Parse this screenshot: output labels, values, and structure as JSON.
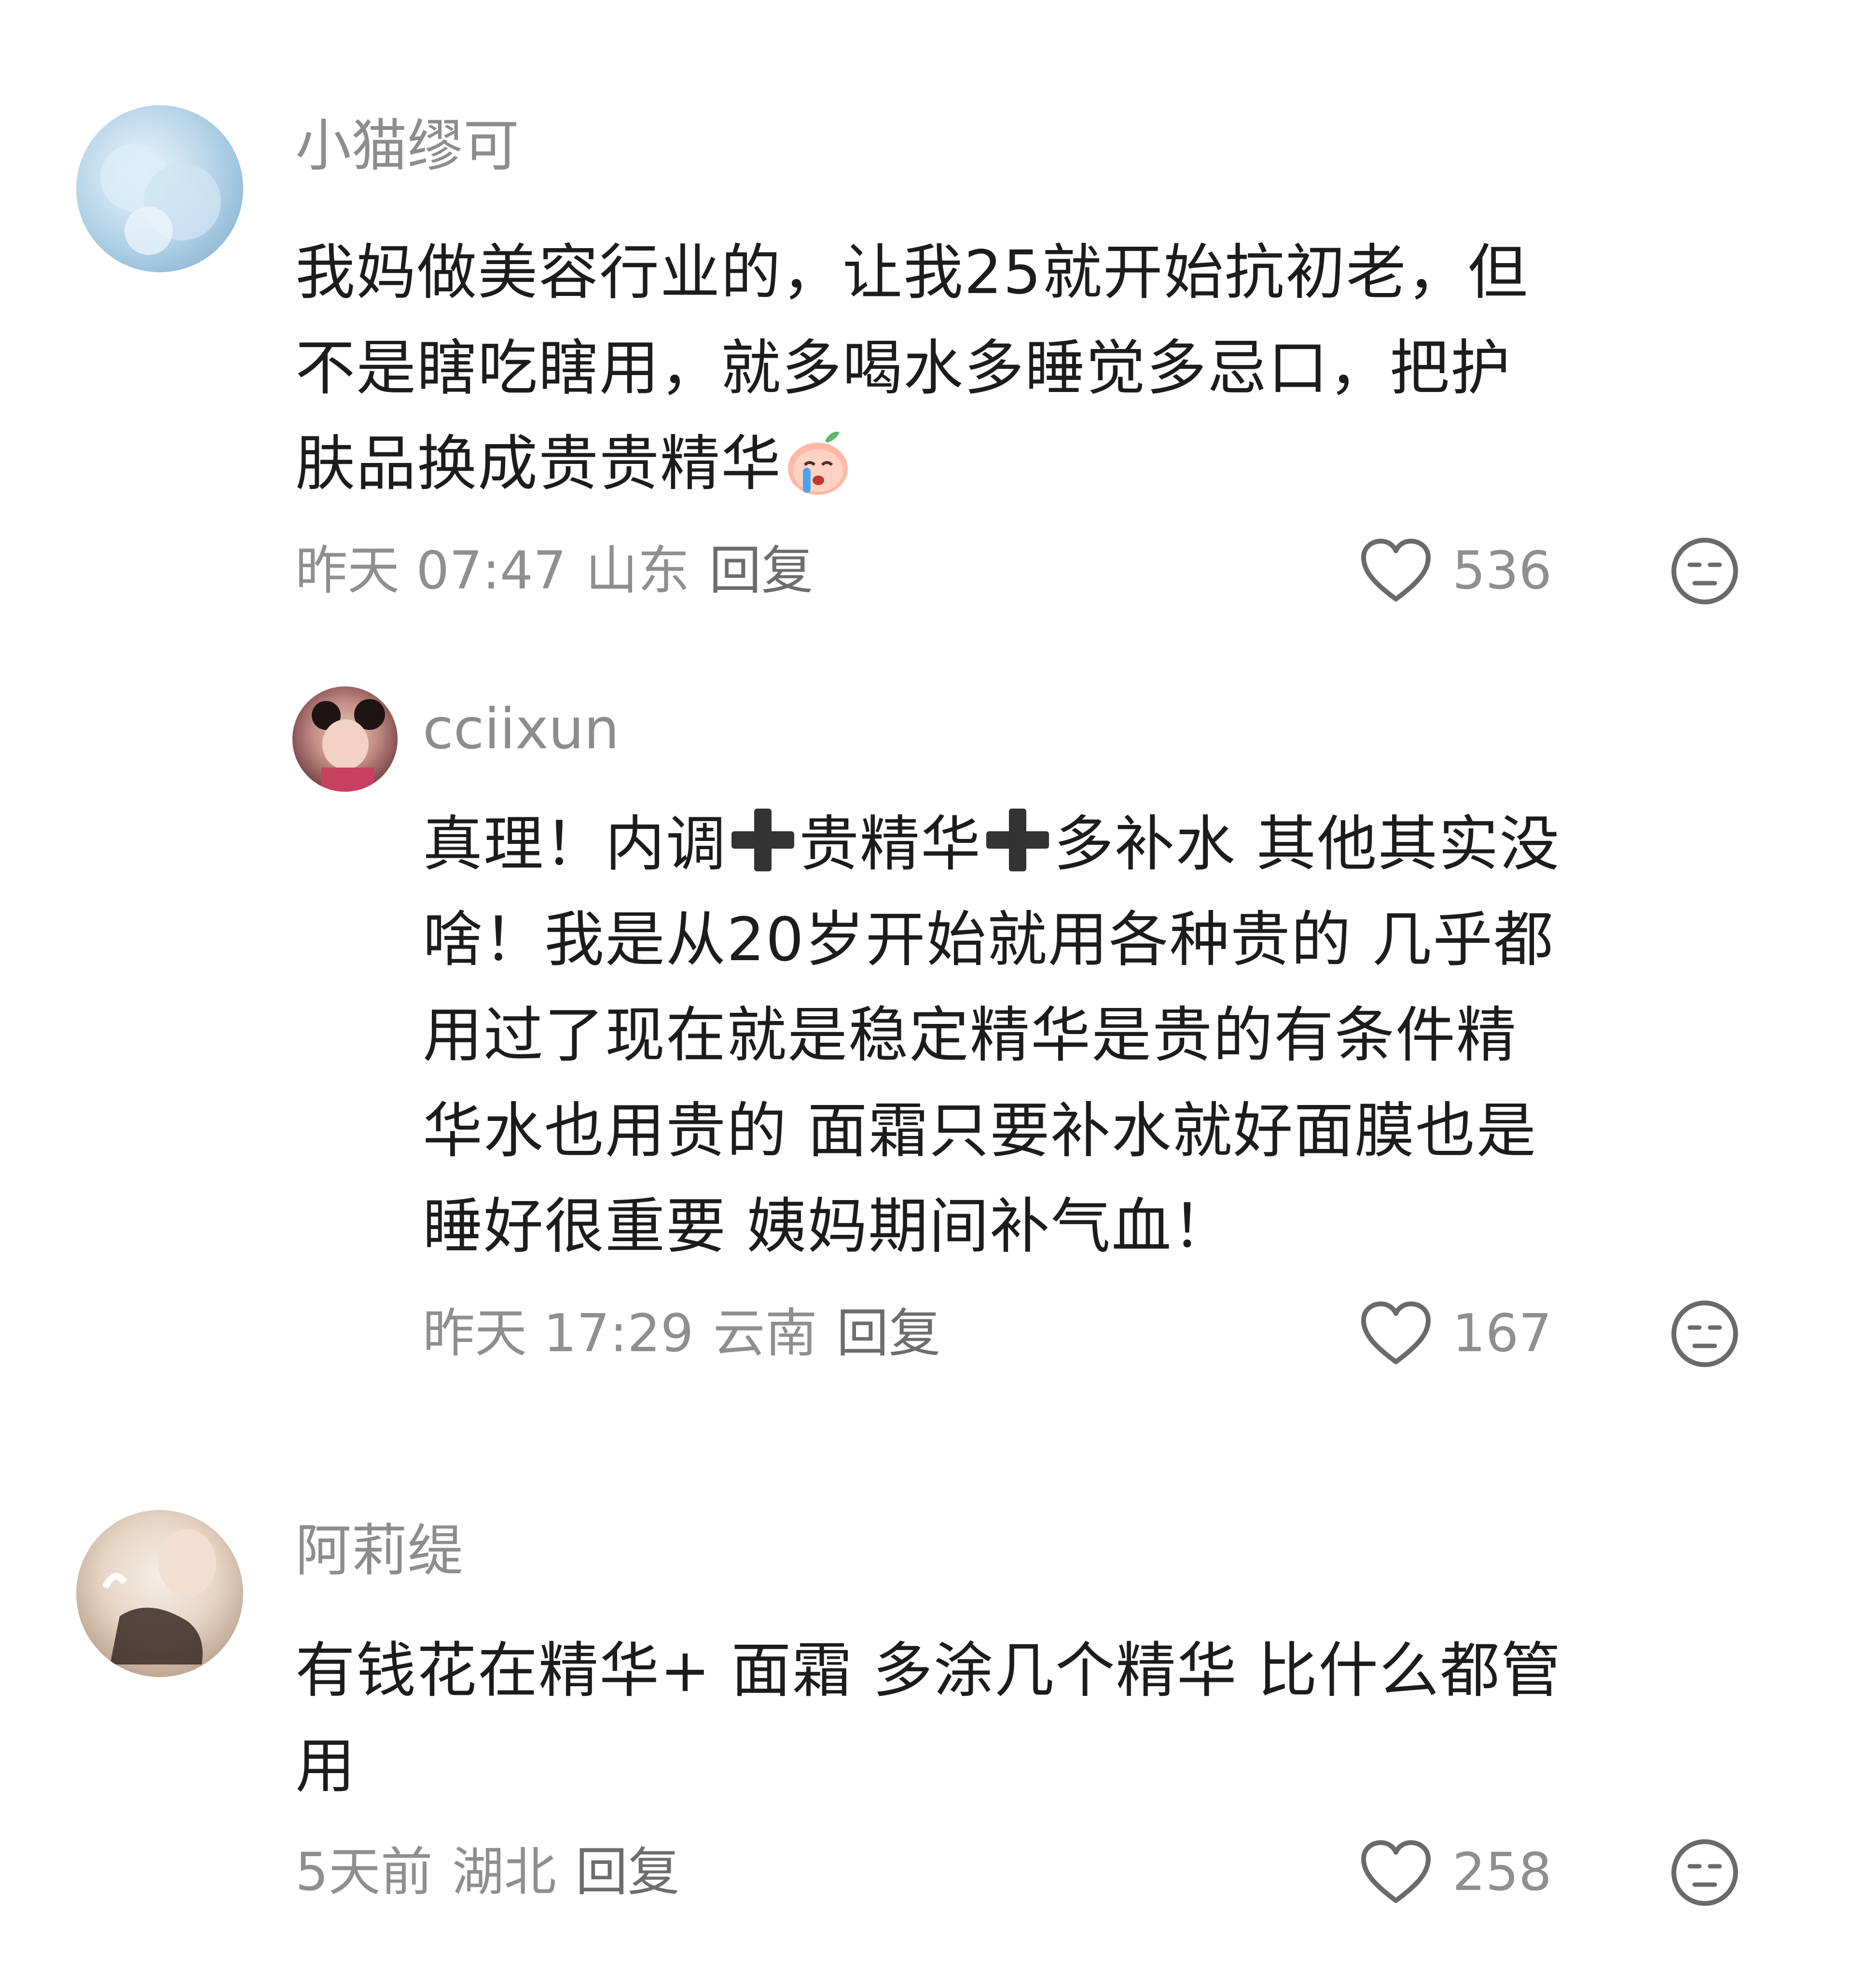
{
  "comments": [
    {
      "username": "小猫缪可",
      "content": "我妈做美容行业的，让我25就开始抗初老，但\n不是瞎吃瞎用，就多喝水多睡觉多忌口，把护\n肤品换成贵贵精华",
      "time": "昨天 07:47",
      "location": "山东",
      "reply_label": "回复",
      "likes": "536"
    },
    {
      "username": "cciixun",
      "content_parts": [
        "真理！内调",
        "贵精华",
        "多补水 其他其实没\n啥！我是从20岁开始就用各种贵的 几乎都\n用过了现在就是稳定精华是贵的有条件精\n华水也用贵的 面霜只要补水就好面膜也是\n睡好很重要 姨妈期间补气血！"
      ],
      "time": "昨天 17:29",
      "location": "云南",
      "reply_label": "回复",
      "likes": "167"
    },
    {
      "username": "阿莉缇",
      "content": "有钱花在精华+ 面霜 多涂几个精华 比什么都管\n用",
      "time": "5天前",
      "location": "湖北",
      "reply_label": "回复",
      "likes": "258"
    }
  ],
  "icons": {
    "like": "heart-outline-icon",
    "dislike": "neutral-face-icon",
    "plus": "heavy-plus-icon",
    "emoji": "crying-peach-emoji"
  },
  "colors": {
    "text_primary": "#1c1c1c",
    "text_secondary": "#8f8f8f",
    "icon_gray": "#6a6a6a"
  }
}
